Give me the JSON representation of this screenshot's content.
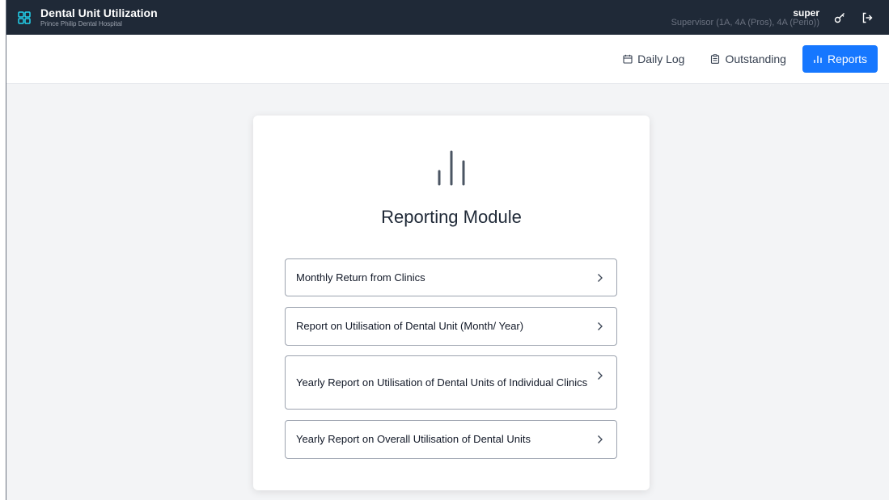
{
  "header": {
    "title": "Dental Unit Utilization",
    "subtitle": "Prince Philip Dental Hospital",
    "user": {
      "name": "super",
      "role": "Supervisor (1A, 4A (Pros), 4A (Perio))"
    },
    "icons": [
      "grid-icon",
      "key-icon",
      "logout-icon"
    ]
  },
  "nav": {
    "items": [
      {
        "label": "Daily Log",
        "icon": "calendar-icon",
        "active": false
      },
      {
        "label": "Outstanding",
        "icon": "clipboard-icon",
        "active": false
      },
      {
        "label": "Reports",
        "icon": "bar-chart-icon",
        "active": true
      }
    ]
  },
  "module": {
    "title": "Reporting Module",
    "icon": "bar-chart-icon",
    "reports": [
      {
        "label": "Monthly Return from Clinics"
      },
      {
        "label": "Report on Utilisation of Dental Unit (Month/ Year)"
      },
      {
        "label": "Yearly Report on Utilisation of Dental Units of Individual Clinics"
      },
      {
        "label": "Yearly Report on Overall Utilisation of Dental Units"
      }
    ]
  },
  "colors": {
    "topbar": "#1f2937",
    "accent": "#1677ff",
    "brand_icon": "#22d3ee",
    "background": "#f3f4f6"
  }
}
